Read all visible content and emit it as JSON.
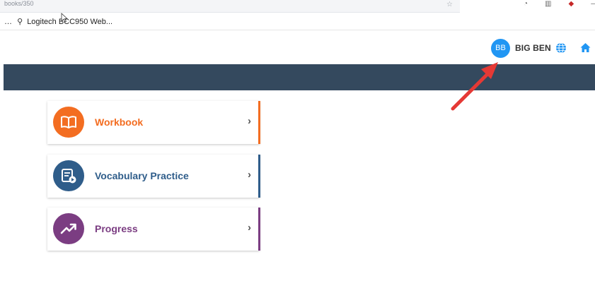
{
  "browser": {
    "url_text": "books/350",
    "bookmark_label": "Logitech BCC950 Web..."
  },
  "header": {
    "avatar_initials": "BB",
    "user_name": "BIG BEN",
    "icons": [
      "globe-icon",
      "home-icon"
    ]
  },
  "colors": {
    "nav_band": "#34495e",
    "avatar": "#2196f3",
    "workbook": "#f36d21",
    "vocabulary": "#2f5d8a",
    "progress": "#7b3d82",
    "annotation_arrow": "#e53935"
  },
  "menu": {
    "items": [
      {
        "label": "Workbook",
        "icon": "book-icon",
        "chevron": "›"
      },
      {
        "label": "Vocabulary Practice",
        "icon": "vocabulary-list-play-icon",
        "chevron": "›"
      },
      {
        "label": "Progress",
        "icon": "trending-up-icon",
        "chevron": "›"
      }
    ]
  }
}
